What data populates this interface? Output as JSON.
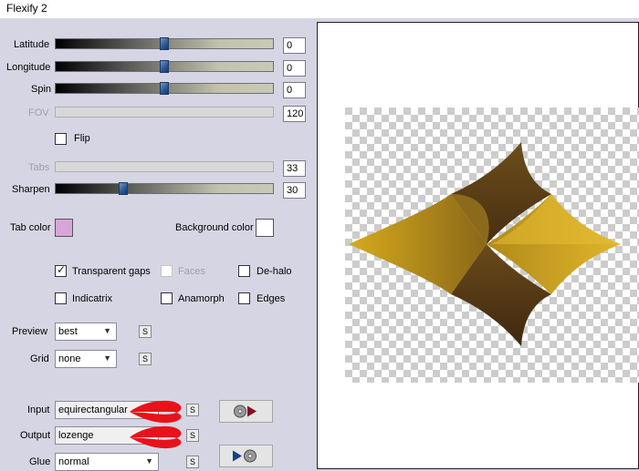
{
  "window": {
    "title": "Flexify 2"
  },
  "sliders": [
    {
      "label": "Latitude",
      "value": "0",
      "position": 0.5,
      "enabled": true
    },
    {
      "label": "Longitude",
      "value": "0",
      "position": 0.5,
      "enabled": true
    },
    {
      "label": "Spin",
      "value": "0",
      "position": 0.5,
      "enabled": true
    },
    {
      "label": "FOV",
      "value": "120",
      "enabled": false
    },
    {
      "label": "Tabs",
      "value": "33",
      "enabled": false
    },
    {
      "label": "Sharpen",
      "value": "30",
      "position": 0.3,
      "enabled": true
    }
  ],
  "flip": {
    "label": "Flip",
    "checked": false
  },
  "colors": {
    "tab_color_label": "Tab color",
    "tab_color": "#d7a6d6",
    "background_color_label": "Background color",
    "background_color": "#ffffff"
  },
  "options": {
    "transparent_gaps": {
      "label": "Transparent gaps",
      "checked": true
    },
    "faces": {
      "label": "Faces",
      "checked": false,
      "enabled": false
    },
    "de_halo": {
      "label": "De-halo",
      "checked": false
    },
    "indicatrix": {
      "label": "Indicatrix",
      "checked": false
    },
    "anamorph": {
      "label": "Anamorph",
      "checked": false
    },
    "edges": {
      "label": "Edges",
      "checked": false
    }
  },
  "preview": {
    "label": "Preview",
    "value": "best"
  },
  "grid": {
    "label": "Grid",
    "value": "none"
  },
  "input": {
    "label": "Input",
    "value": "equirectangular"
  },
  "output": {
    "label": "Output",
    "value": "lozenge"
  },
  "glue": {
    "label": "Glue",
    "value": "normal"
  },
  "small_buttons": {
    "s_label": "S"
  },
  "accent_colors": {
    "annotation_arrow": "#e8121b",
    "shape_gold": "#c9a21a",
    "shape_dark": "#4a3115"
  }
}
